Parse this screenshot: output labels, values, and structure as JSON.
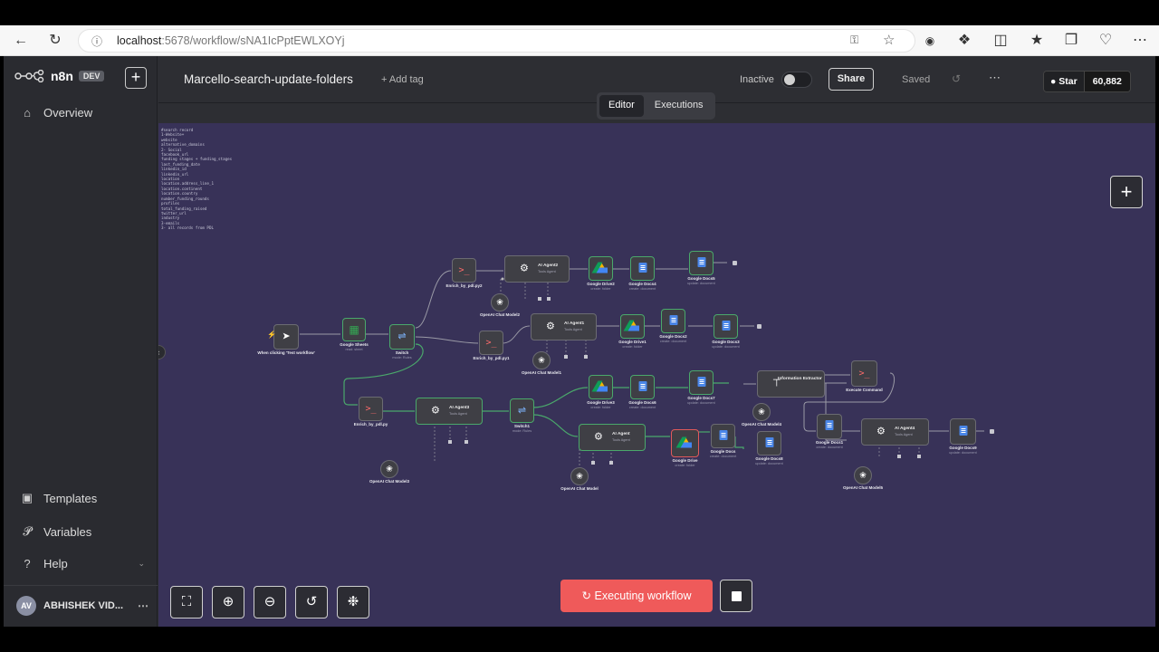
{
  "browser": {
    "url_host": "localhost",
    "url_path": ":5678/workflow/sNA1IcPptEWLXOYj"
  },
  "sidebar": {
    "logo": "n8n",
    "badge": "DEV",
    "items": [
      {
        "label": "Overview",
        "icon": "home-icon"
      },
      {
        "label": "Templates",
        "icon": "templates-icon"
      },
      {
        "label": "Variables",
        "icon": "variables-icon"
      },
      {
        "label": "Help",
        "icon": "help-icon"
      }
    ],
    "user_initials": "AV",
    "user_name": "ABHISHEK VID..."
  },
  "header": {
    "workflow_name": "Marcello-search-update-folders",
    "add_tag": "+ Add tag",
    "status": "Inactive",
    "share": "Share",
    "saved": "Saved",
    "github_star": "Star",
    "github_count": "60,882"
  },
  "tabs": [
    {
      "label": "Editor",
      "active": true
    },
    {
      "label": "Executions",
      "active": false
    }
  ],
  "canvas": {
    "notes": [
      "#search record",
      "1-Website+",
      "website",
      "alternative_domains",
      "2- Social",
      "facebook_url",
      "funding stages + funding_stages",
      "last_funding_date",
      "linkedin_id",
      "linkedin_url",
      "location",
      "location.address_line_1",
      "location.continent",
      "location.country",
      "number_funding_rounds",
      "profiles",
      "total_funding_raised",
      "twitter_url",
      "industry",
      "3-emails",
      "3- all records from PDL"
    ],
    "nodes": [
      {
        "title": "When clicking 'Test workflow'",
        "sub": ""
      },
      {
        "title": "Google Sheets",
        "sub": "read: sheet"
      },
      {
        "title": "Switch",
        "sub": "mode: Rules"
      },
      {
        "title": "Enrich_by_pdl.py2",
        "sub": ""
      },
      {
        "title": "AI Agent2",
        "sub": "Tools Agent"
      },
      {
        "title": "Google Drive2",
        "sub": "create: folder"
      },
      {
        "title": "Google Docs4",
        "sub": "create: document"
      },
      {
        "title": "Google Docs5",
        "sub": "update: document"
      },
      {
        "title": "OpenAI Chat Model2",
        "sub": ""
      },
      {
        "title": "Enrich_by_pdl.py1",
        "sub": ""
      },
      {
        "title": "AI Agent1",
        "sub": "Tools Agent"
      },
      {
        "title": "Google Drive1",
        "sub": "create: folder"
      },
      {
        "title": "Google Docs2",
        "sub": "create: document"
      },
      {
        "title": "Google Docs3",
        "sub": "update: document"
      },
      {
        "title": "OpenAI Chat Model1",
        "sub": ""
      },
      {
        "title": "Enrich_by_pdl.py",
        "sub": ""
      },
      {
        "title": "AI Agent3",
        "sub": "Tools Agent"
      },
      {
        "title": "OpenAI Chat Model3",
        "sub": ""
      },
      {
        "title": "Switch1",
        "sub": "mode: Rules"
      },
      {
        "title": "Google Drive3",
        "sub": "create: folder"
      },
      {
        "title": "Google Docs6",
        "sub": "create: document"
      },
      {
        "title": "Google Docs7",
        "sub": "update: document"
      },
      {
        "title": "AI Agent",
        "sub": "Tools Agent"
      },
      {
        "title": "Google Drive",
        "sub": "create: folder"
      },
      {
        "title": "Google Docs",
        "sub": "create: document"
      },
      {
        "title": "Google Docs8",
        "sub": "update: document"
      },
      {
        "title": "OpenAI Chat Model",
        "sub": ""
      },
      {
        "title": "Information Extractor",
        "sub": ""
      },
      {
        "title": "OpenAI Chat Model4",
        "sub": ""
      },
      {
        "title": "Execute Command",
        "sub": ""
      },
      {
        "title": "Google Docs1",
        "sub": "create: document"
      },
      {
        "title": "AI Agent4",
        "sub": "Tools Agent"
      },
      {
        "title": "Google Docs9",
        "sub": "update: document"
      },
      {
        "title": "OpenAI Chat Model5",
        "sub": ""
      }
    ]
  },
  "execute_button": "Executing workflow",
  "colors": {
    "canvas_bg": "#383258",
    "accent": "#ef5a5a",
    "success": "#4aa86b"
  }
}
